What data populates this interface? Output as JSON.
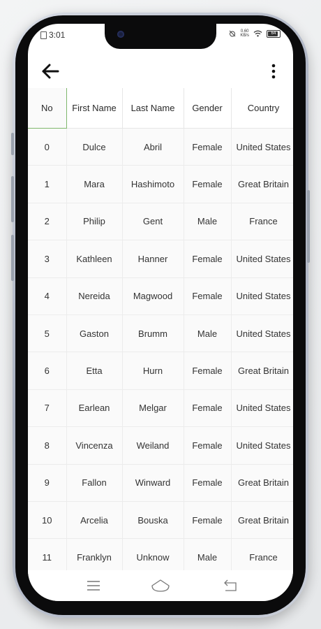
{
  "status_bar": {
    "time": "3:01",
    "net_speed_value": "0.60",
    "net_speed_unit": "KB/s",
    "battery_level": "64"
  },
  "app_bar": {
    "back_icon": "arrow-left-icon",
    "menu_icon": "more-vertical-icon"
  },
  "table": {
    "headers": [
      "No",
      "First Name",
      "Last Name",
      "Gender",
      "Country"
    ],
    "rows": [
      [
        "0",
        "Dulce",
        "Abril",
        "Female",
        "United States"
      ],
      [
        "1",
        "Mara",
        "Hashimoto",
        "Female",
        "Great Britain"
      ],
      [
        "2",
        "Philip",
        "Gent",
        "Male",
        "France"
      ],
      [
        "3",
        "Kathleen",
        "Hanner",
        "Female",
        "United States"
      ],
      [
        "4",
        "Nereida",
        "Magwood",
        "Female",
        "United States"
      ],
      [
        "5",
        "Gaston",
        "Brumm",
        "Male",
        "United States"
      ],
      [
        "6",
        "Etta",
        "Hurn",
        "Female",
        "Great Britain"
      ],
      [
        "7",
        "Earlean",
        "Melgar",
        "Female",
        "United States"
      ],
      [
        "8",
        "Vincenza",
        "Weiland",
        "Female",
        "United States"
      ],
      [
        "9",
        "Fallon",
        "Winward",
        "Female",
        "Great Britain"
      ],
      [
        "10",
        "Arcelia",
        "Bouska",
        "Female",
        "Great Britain"
      ],
      [
        "11",
        "Franklyn",
        "Unknow",
        "Male",
        "France"
      ]
    ],
    "selected_header_color": "#7fb86c"
  },
  "nav_bar": {
    "menu_icon": "hamburger-icon",
    "home_icon": "home-icon",
    "back_icon": "return-icon"
  }
}
